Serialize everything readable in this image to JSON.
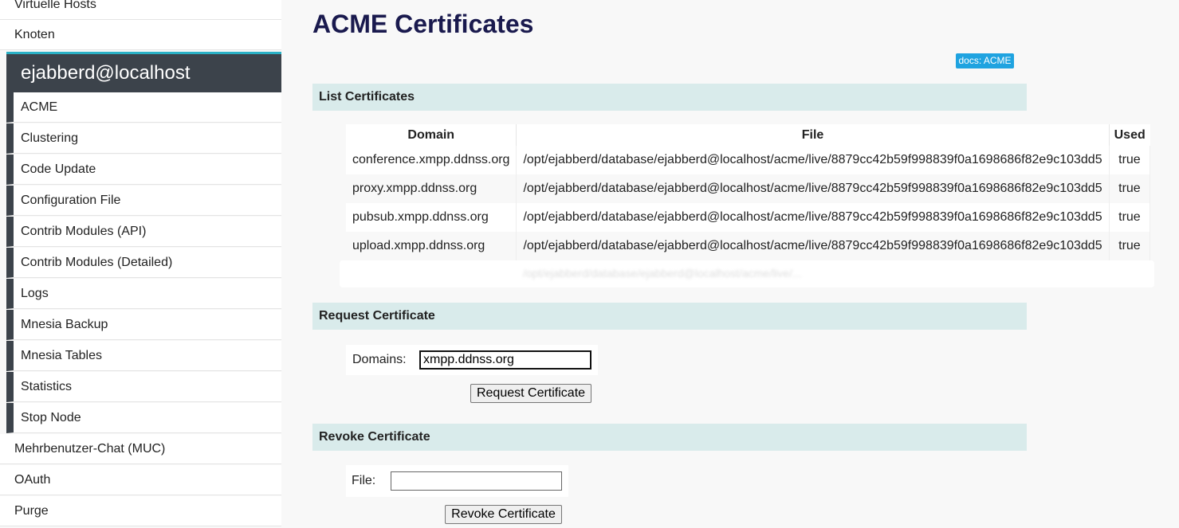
{
  "sidebar": {
    "top_items": [
      {
        "label": "Virtuelle Hosts"
      },
      {
        "label": "Knoten"
      }
    ],
    "node_header": "ejabberd@localhost",
    "node_items": [
      {
        "label": "ACME"
      },
      {
        "label": "Clustering"
      },
      {
        "label": "Code Update"
      },
      {
        "label": "Configuration File"
      },
      {
        "label": "Contrib Modules (API)"
      },
      {
        "label": "Contrib Modules (Detailed)"
      },
      {
        "label": "Logs"
      },
      {
        "label": "Mnesia Backup"
      },
      {
        "label": "Mnesia Tables"
      },
      {
        "label": "Statistics"
      },
      {
        "label": "Stop Node"
      }
    ],
    "bottom_items": [
      {
        "label": "Mehrbenutzer-Chat (MUC)"
      },
      {
        "label": "OAuth"
      },
      {
        "label": "Purge"
      }
    ]
  },
  "page": {
    "title": "ACME Certificates",
    "docs_link": "docs: ACME"
  },
  "list_section": {
    "title": "List Certificates",
    "headers": [
      "Domain",
      "File",
      "Used"
    ],
    "rows": [
      {
        "domain": "conference.xmpp.ddnss.org",
        "file": "/opt/ejabberd/database/ejabberd@localhost/acme/live/8879cc42b59f998839f0a1698686f82e9c103dd5",
        "used": "true"
      },
      {
        "domain": "proxy.xmpp.ddnss.org",
        "file": "/opt/ejabberd/database/ejabberd@localhost/acme/live/8879cc42b59f998839f0a1698686f82e9c103dd5",
        "used": "true"
      },
      {
        "domain": "pubsub.xmpp.ddnss.org",
        "file": "/opt/ejabberd/database/ejabberd@localhost/acme/live/8879cc42b59f998839f0a1698686f82e9c103dd5",
        "used": "true"
      },
      {
        "domain": "upload.xmpp.ddnss.org",
        "file": "/opt/ejabberd/database/ejabberd@localhost/acme/live/8879cc42b59f998839f0a1698686f82e9c103dd5",
        "used": "true"
      }
    ],
    "partial_row_text": "/opt/ejabberd/database/ejabberd@localhost/acme/live/..."
  },
  "request_section": {
    "title": "Request Certificate",
    "domains_label": "Domains:",
    "domains_value": "xmpp.ddnss.org",
    "button_label": "Request Certificate"
  },
  "revoke_section": {
    "title": "Revoke Certificate",
    "file_label": "File:",
    "file_value": "",
    "button_label": "Revoke Certificate"
  },
  "colors": {
    "node_header_bg": "#3c434b",
    "accent": "#2ab1c6",
    "section_bg": "#d9ebeb",
    "title": "#1a1a4e",
    "docs_badge": "#1fa3e0"
  }
}
